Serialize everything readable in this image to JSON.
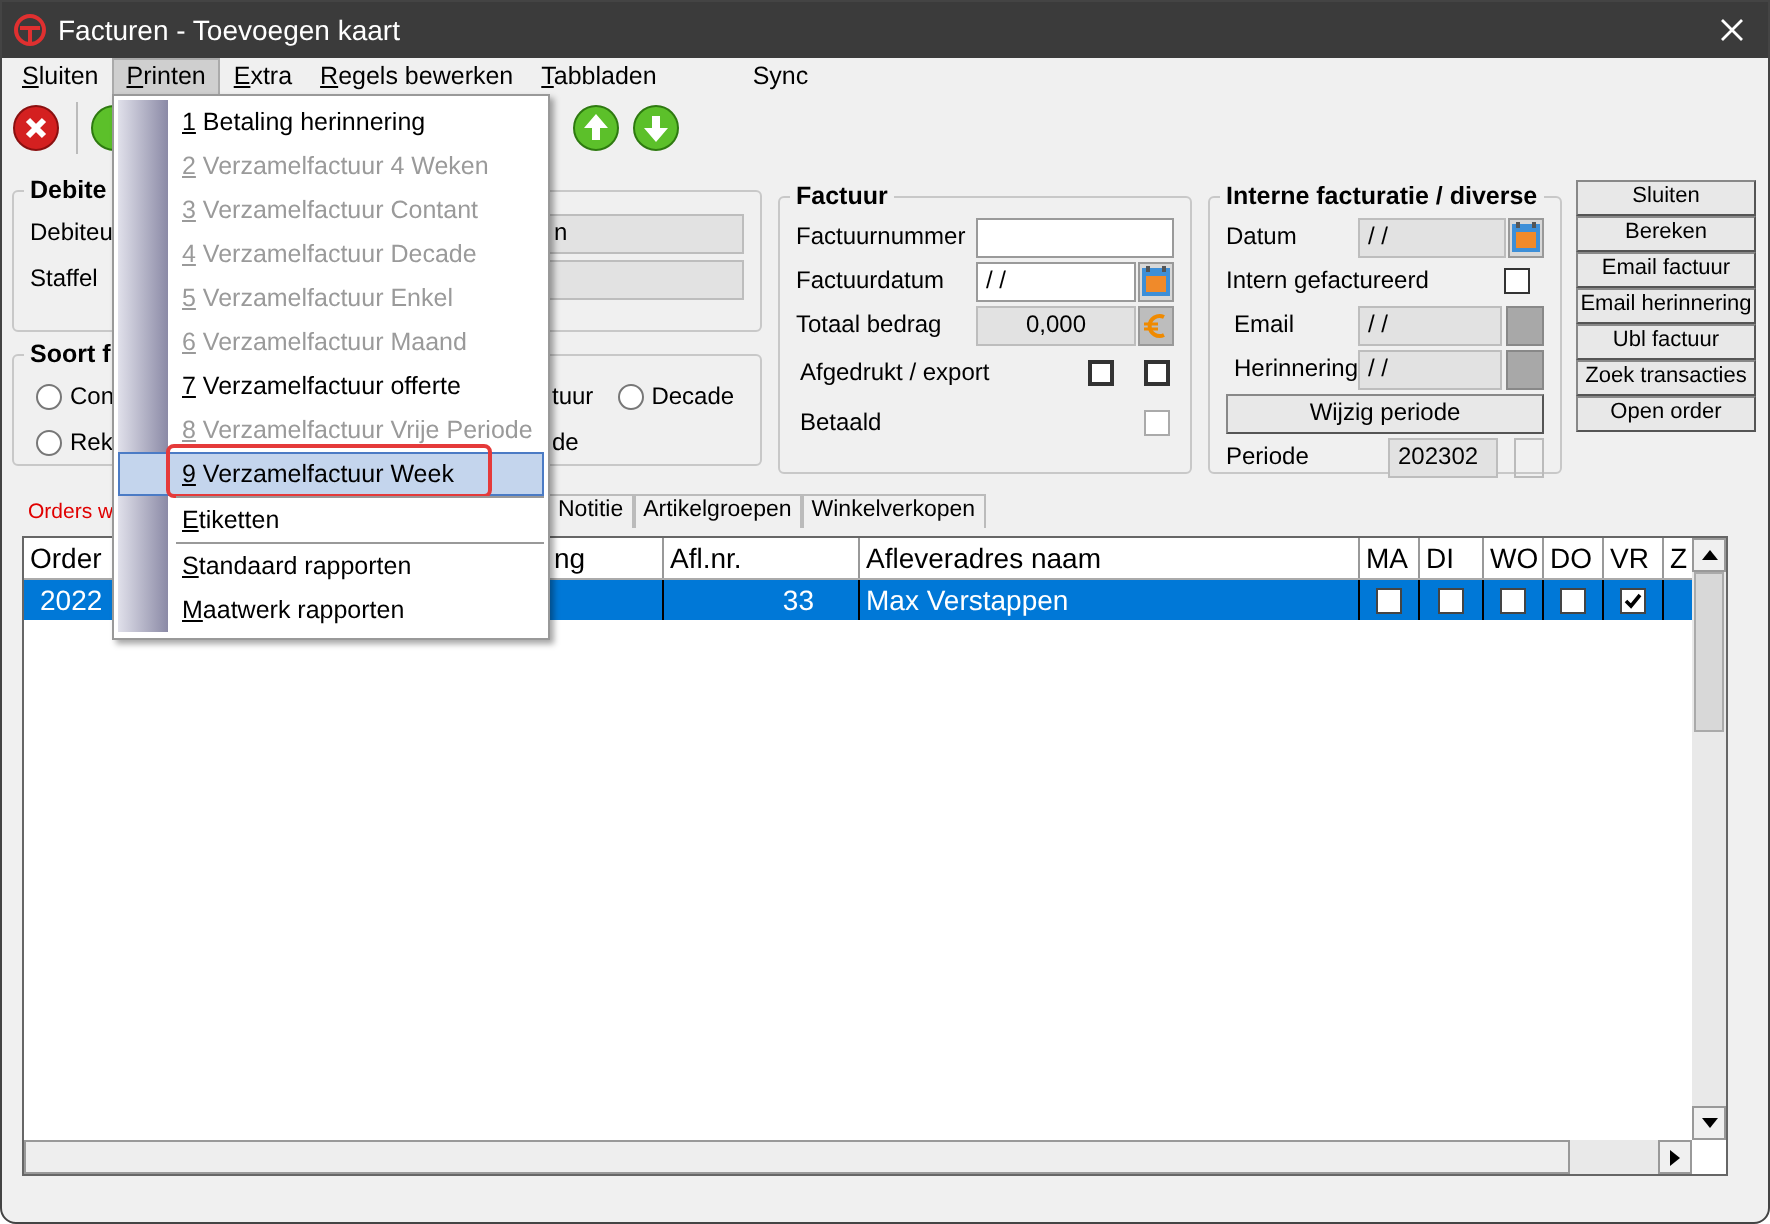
{
  "window": {
    "title": "Facturen - Toevoegen kaart"
  },
  "menu_bar": [
    {
      "label": "Sluiten",
      "mnemonic": true,
      "selected": false
    },
    {
      "label": "Printen",
      "mnemonic": true,
      "selected": true
    },
    {
      "label": "Extra",
      "mnemonic": true,
      "selected": false
    },
    {
      "label": "Regels bewerken",
      "mnemonic": true,
      "selected": false
    },
    {
      "label": "Tabbladen",
      "mnemonic": true,
      "selected": false
    },
    {
      "label": "Sync",
      "mnemonic": false,
      "selected": false
    }
  ],
  "debiteur_group": {
    "title": "Debite",
    "fields": [
      {
        "label": "Debiteu",
        "value": "n"
      },
      {
        "label": "Staffel"
      }
    ]
  },
  "soort_group": {
    "title": "Soort f",
    "rows": [
      [
        {
          "kind": "radio",
          "label": "Con",
          "checked": false
        },
        {
          "kind": "text",
          "label": "tuur"
        },
        {
          "kind": "radio",
          "label": "Decade",
          "checked": false
        }
      ],
      [
        {
          "kind": "radio",
          "label": "Rek",
          "checked": false
        },
        {
          "kind": "text",
          "label": "de"
        }
      ]
    ]
  },
  "factuur": {
    "title": "Factuur",
    "rows": [
      {
        "kind": "input",
        "label": "Factuurnummer"
      },
      {
        "kind": "date",
        "label": "Factuurdatum",
        "value": "/ /"
      },
      {
        "kind": "amount",
        "label": "Totaal bedrag",
        "value": "0,000"
      },
      {
        "kind": "checks",
        "label": "Afgedrukt / export",
        "checks": [
          {
            "checked": false,
            "disabled": false
          },
          {
            "checked": false,
            "disabled": false
          }
        ]
      },
      {
        "kind": "checks",
        "label": "Betaald",
        "checks": [
          {
            "checked": false,
            "disabled": true
          }
        ]
      }
    ]
  },
  "interne": {
    "title": "Interne facturatie / diverse",
    "rows": [
      {
        "kind": "date",
        "label": "Datum",
        "value": "/ /"
      },
      {
        "kind": "check",
        "label": "Intern gefactureerd",
        "checked": false
      },
      {
        "kind": "greydate",
        "label": "Email",
        "value": "/ /"
      },
      {
        "kind": "greydate",
        "label": "Herinnering",
        "value": "/ /"
      },
      {
        "kind": "button",
        "label": "Wijzig periode"
      },
      {
        "kind": "period",
        "label": "Periode",
        "value": "202302"
      }
    ]
  },
  "side_buttons": [
    "Sluiten",
    "Bereken",
    "Email factuur",
    "Email herinnering",
    "Ubl factuur",
    "Zoek transacties",
    "Open order"
  ],
  "tabs": [
    {
      "label": "Orders w",
      "selected": true
    },
    {
      "label": "Notitie",
      "selected": false
    },
    {
      "label": "Artikelgroepen",
      "selected": false
    },
    {
      "label": "Winkelverkopen",
      "selected": false
    }
  ],
  "grid": {
    "columns": [
      "Order",
      "ng",
      "Afl.nr.",
      "Afleveradres naam",
      "MA",
      "DI",
      "WO",
      "DO",
      "VR",
      "Z"
    ],
    "rows": [
      {
        "selected": true,
        "order": "2022",
        "afl_nr": "33",
        "name": "Max Verstappen",
        "days": [
          {
            "checked": false
          },
          {
            "checked": false
          },
          {
            "checked": false
          },
          {
            "checked": false
          },
          {
            "checked": true
          }
        ]
      }
    ]
  },
  "print_menu": {
    "items": [
      {
        "kind": "item",
        "label": "1 Betaling herinnering",
        "mnemonic": true,
        "disabled": false,
        "selected": false,
        "annotated": false
      },
      {
        "kind": "item",
        "label": "2 Verzamelfactuur 4 Weken",
        "mnemonic": true,
        "disabled": true,
        "selected": false,
        "annotated": false
      },
      {
        "kind": "item",
        "label": "3 Verzamelfactuur Contant",
        "mnemonic": true,
        "disabled": true,
        "selected": false,
        "annotated": false
      },
      {
        "kind": "item",
        "label": "4 Verzamelfactuur Decade",
        "mnemonic": true,
        "disabled": true,
        "selected": false,
        "annotated": false
      },
      {
        "kind": "item",
        "label": "5 Verzamelfactuur Enkel",
        "mnemonic": true,
        "disabled": true,
        "selected": false,
        "annotated": false
      },
      {
        "kind": "item",
        "label": "6 Verzamelfactuur Maand",
        "mnemonic": true,
        "disabled": true,
        "selected": false,
        "annotated": false
      },
      {
        "kind": "item",
        "label": "7 Verzamelfactuur offerte",
        "mnemonic": true,
        "disabled": false,
        "selected": false,
        "annotated": false
      },
      {
        "kind": "item",
        "label": "8 Verzamelfactuur Vrije Periode",
        "mnemonic": true,
        "disabled": true,
        "selected": false,
        "annotated": false
      },
      {
        "kind": "item",
        "label": "9 Verzamelfactuur Week",
        "mnemonic": true,
        "disabled": false,
        "selected": true,
        "annotated": true
      },
      {
        "kind": "separator"
      },
      {
        "kind": "item",
        "label": "Etiketten",
        "mnemonic": true,
        "disabled": false,
        "selected": false,
        "annotated": false
      },
      {
        "kind": "separator"
      },
      {
        "kind": "item",
        "label": "Standaard rapporten",
        "mnemonic": true,
        "disabled": false,
        "selected": false,
        "annotated": false
      },
      {
        "kind": "item",
        "label": "Maatwerk rapporten",
        "mnemonic": true,
        "disabled": false,
        "selected": false,
        "annotated": false
      }
    ]
  }
}
